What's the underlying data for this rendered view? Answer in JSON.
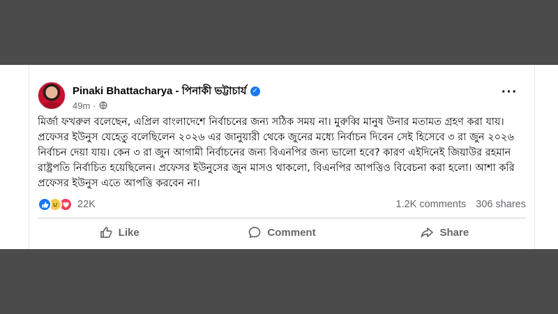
{
  "post": {
    "author": "Pinaki Bhattacharya - পিনাকী ভট্টাচার্য",
    "time": "49m",
    "dot": "·",
    "more_label": "···",
    "verified_mark": "✓",
    "text": "মির্জা ফখরুল বলেছেন, এপ্রিল বাংলাদেশে নির্বাচনের জন্য সঠিক সময় না। মুরুব্বি মানুষ উনার মতামত গ্রহণ করা যায়। প্রফেসর ইউনুস যেহেতু বলেছিলেন ২০২৬ এর জানুয়ারী থেকে জুনের মধ্যে নির্বাচন দিবেন সেই হিসেবে ৩ রা জুন ২০২৬ নির্বাচন দেয়া যায়। কেন ৩ রা জুন আগামী নির্বাচনের জন্য বিএনপির জন্য ভালো হবে? কারণ এইদিনেই জিয়াউর রহমান রাষ্ট্রপতি নির্বাচিত হয়েছিলেন। প্রফেসর ইউনুসের জুন মাসও থাকলো, বিএনপির আপত্তিও বিবেচনা করা হলো। আশা করি প্রফেসর ইউনুস এতে আপত্তি করবেন না।"
  },
  "stats": {
    "reactions": "22K",
    "comments": "1.2K comments",
    "shares": "306 shares",
    "reaction_icons": [
      "like-icon",
      "haha-icon",
      "love-icon"
    ]
  },
  "actions": {
    "like": "Like",
    "comment": "Comment",
    "share": "Share"
  },
  "colors": {
    "background": "#4b4b4b",
    "card": "#ffffff",
    "accent": "#1877f2",
    "muted_text": "#65676b"
  }
}
